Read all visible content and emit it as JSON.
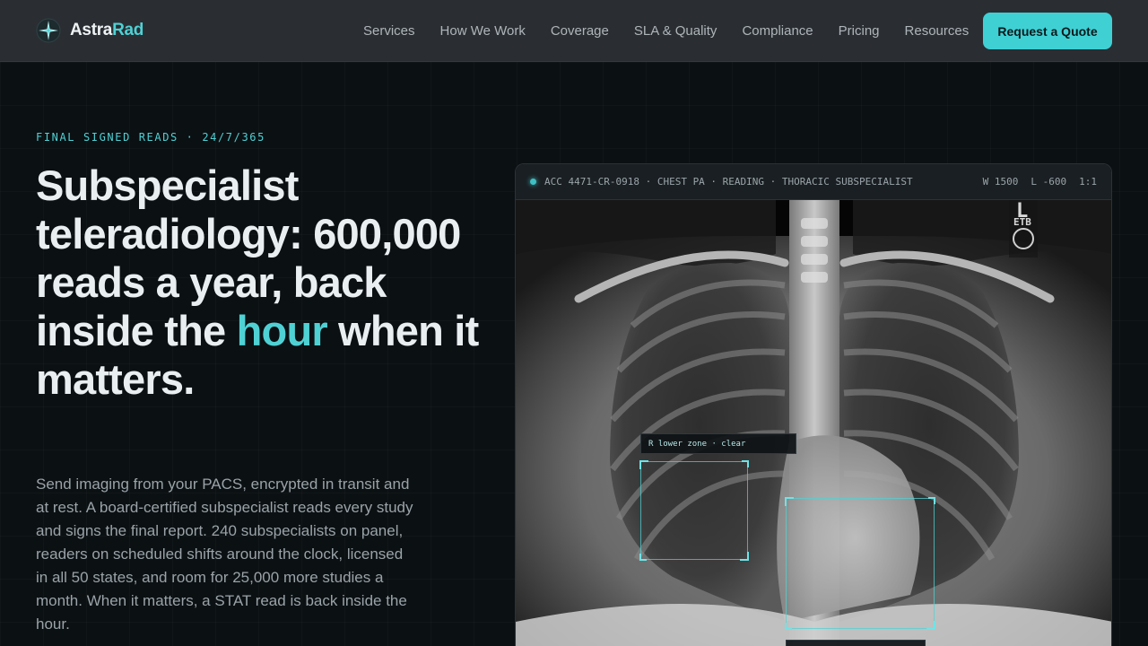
{
  "brand": {
    "name_part1": "Astra",
    "name_part2": "Rad"
  },
  "nav": {
    "items": [
      "Services",
      "How We Work",
      "Coverage",
      "SLA & Quality",
      "Compliance",
      "Pricing",
      "Resources"
    ],
    "cta_label": "Request a Quote"
  },
  "hero": {
    "eyebrow": "FINAL SIGNED READS · 24/7/365",
    "headline_before": "Subspecialist teleradiology: 600,000 reads a year, back inside the ",
    "headline_accent": "hour",
    "headline_after": " when it matters.",
    "lede": "Send imaging from your PACS, encrypted in transit and at rest. A board-certified subspecialist reads every study and signs the final report. 240 subspecialists on panel, readers on scheduled shifts around the clock, licensed in all 50 states, and room for 25,000 more studies a month. When it matters, a STAT read is back inside the hour."
  },
  "viewer": {
    "study_info": "ACC 4471-CR-0918 · CHEST PA · READING · THORACIC SUBSPECIALIST",
    "window": "W 1500",
    "level": "L -600",
    "zoom": "1:1",
    "marker_letter": "L",
    "marker_tag": "ETB",
    "annotation_1": "R lower zone · clear"
  },
  "colors": {
    "accent": "#4fd1d4",
    "cta_bg": "#3fd0d4",
    "nav_bg": "#2a2e33",
    "page_bg": "#0b1013"
  }
}
